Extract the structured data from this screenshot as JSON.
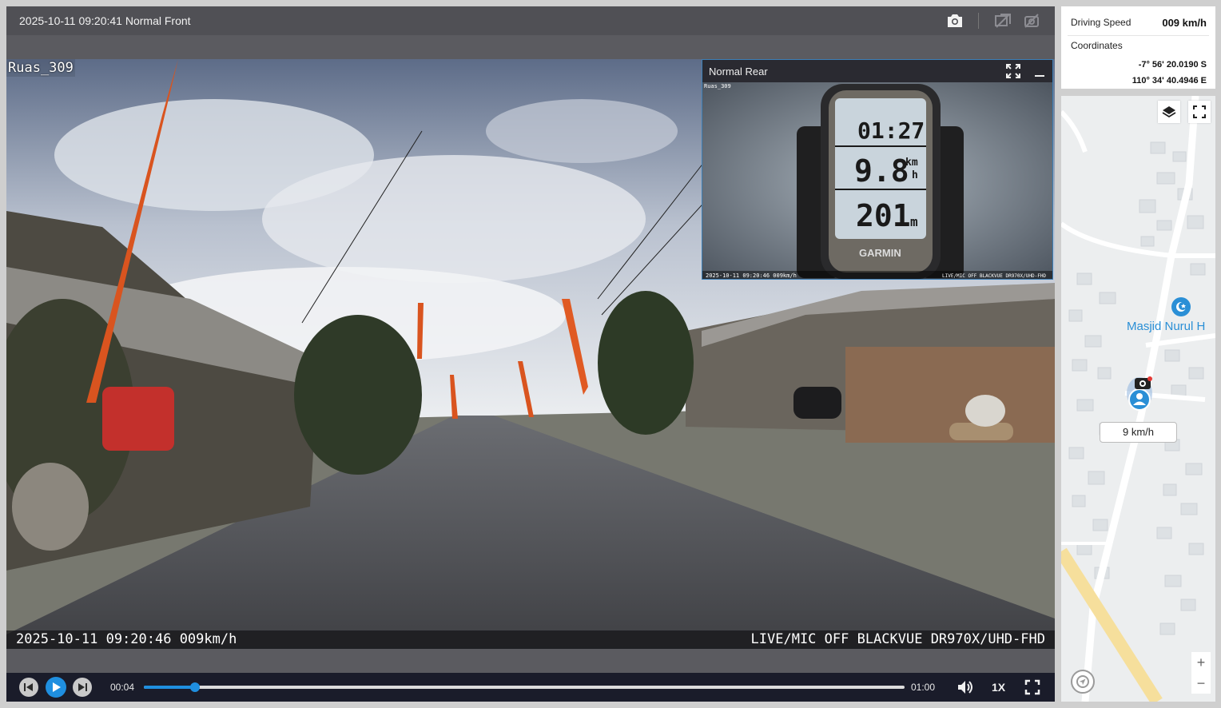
{
  "video": {
    "title": "2025-10-11 09:20:41 Normal Front",
    "overlay_label": "Ruas_309",
    "osd_left": "2025-10-11 09:20:46 009km/h",
    "osd_right": "LIVE/MIC OFF BLACKVUE DR970X/UHD-FHD",
    "header_icons": [
      "camera-icon",
      "compare-icon",
      "pip-toggle-icon"
    ]
  },
  "rear": {
    "title": "Normal Rear",
    "overlay_label": "Ruas_309",
    "osd_left": "2025-10-11 09:20:46 009km/h",
    "osd_right": "LIVE/MIC OFF BLACKVUE DR970X/UHD-FHD",
    "gps": {
      "time": "01:27",
      "speed": "9.8",
      "speed_unit_top": "km",
      "speed_unit_bottom": "h",
      "distance": "201",
      "distance_unit": "m",
      "brand": "GARMIN"
    },
    "icons": [
      "expand-icon",
      "minimize-icon"
    ]
  },
  "controls": {
    "time_current": "00:04",
    "time_total": "01:00",
    "progress": 0.067,
    "playback_rate": "1X",
    "icons": [
      "previous-icon",
      "play-icon",
      "next-icon",
      "volume-icon",
      "fullscreen-icon"
    ],
    "accent": "#1f8fe0"
  },
  "info": {
    "speed_label": "Driving Speed",
    "speed_value": "009 km/h",
    "coords_label": "Coordinates",
    "latitude": "-7° 56' 20.0190 S",
    "longitude": "110° 34' 40.4946 E"
  },
  "map": {
    "poi_label": "Masjid Nurul H",
    "speed_tag": "9 km/h",
    "zoom_in": "+",
    "zoom_out": "−",
    "icons": [
      "layers-icon",
      "map-fullscreen-icon",
      "mosque-icon",
      "vehicle-marker-icon",
      "compass-icon"
    ],
    "poi_color": "#2a8fd6"
  }
}
